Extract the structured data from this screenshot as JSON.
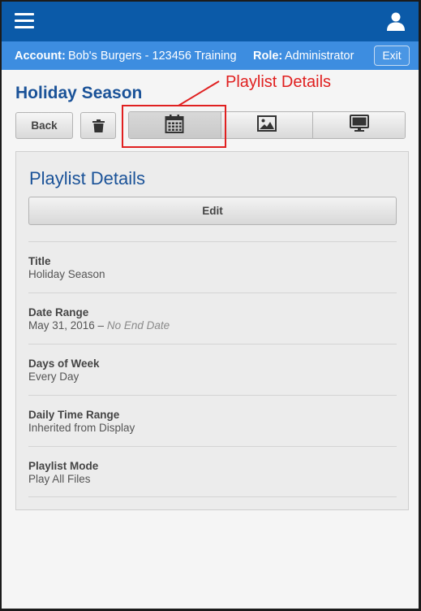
{
  "header": {
    "menu_icon": "hamburger-menu-icon",
    "user_icon": "user-icon"
  },
  "account_bar": {
    "account_label": "Account:",
    "account_value": "Bob's Burgers - 123456 Training",
    "role_label": "Role:",
    "role_value": "Administrator",
    "exit_label": "Exit"
  },
  "page": {
    "title": "Holiday Season"
  },
  "annotation": {
    "text": "Playlist Details"
  },
  "toolbar": {
    "back_label": "Back",
    "trash_icon": "trash-icon",
    "tabs": [
      {
        "icon": "calendar-icon",
        "active": true
      },
      {
        "icon": "image-icon",
        "active": false
      },
      {
        "icon": "monitor-icon",
        "active": false
      }
    ]
  },
  "details": {
    "title": "Playlist Details",
    "edit_label": "Edit",
    "fields": [
      {
        "label": "Title",
        "value": "Holiday Season"
      },
      {
        "label": "Date Range",
        "value": "May 31, 2016 – ",
        "value_extra": "No End Date"
      },
      {
        "label": "Days of Week",
        "value": "Every Day"
      },
      {
        "label": "Daily Time Range",
        "value": "Inherited from Display"
      },
      {
        "label": "Playlist Mode",
        "value": "Play All Files"
      }
    ]
  },
  "colors": {
    "header_blue": "#0b5aa8",
    "account_blue": "#3d8de0",
    "title_blue": "#1a5298",
    "annotation_red": "#e02020"
  }
}
